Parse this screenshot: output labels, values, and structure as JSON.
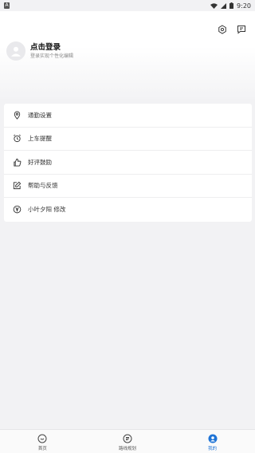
{
  "status_bar": {
    "time": "9:20",
    "left_icon_text": "A"
  },
  "header": {
    "login_title": "点击登录",
    "login_subtitle": "登录实现个性化编辑"
  },
  "menu": {
    "items": [
      {
        "label": "通勤设置",
        "icon": "location-pin-icon"
      },
      {
        "label": "上车提醒",
        "icon": "alarm-clock-icon"
      },
      {
        "label": "好评鼓励",
        "icon": "thumbs-up-icon"
      },
      {
        "label": "帮助与反馈",
        "icon": "edit-icon"
      },
      {
        "label": "小叶夕阳 修改",
        "icon": "yen-circle-icon"
      }
    ]
  },
  "bottom_nav": {
    "items": [
      {
        "label": "首页",
        "icon": "home-smile-icon",
        "active": false
      },
      {
        "label": "路线规划",
        "icon": "route-plan-icon",
        "active": false
      },
      {
        "label": "我的",
        "icon": "profile-icon",
        "active": true
      }
    ]
  },
  "colors": {
    "accent": "#1f74d6",
    "background": "#f2f2f4",
    "card": "#ffffff"
  }
}
